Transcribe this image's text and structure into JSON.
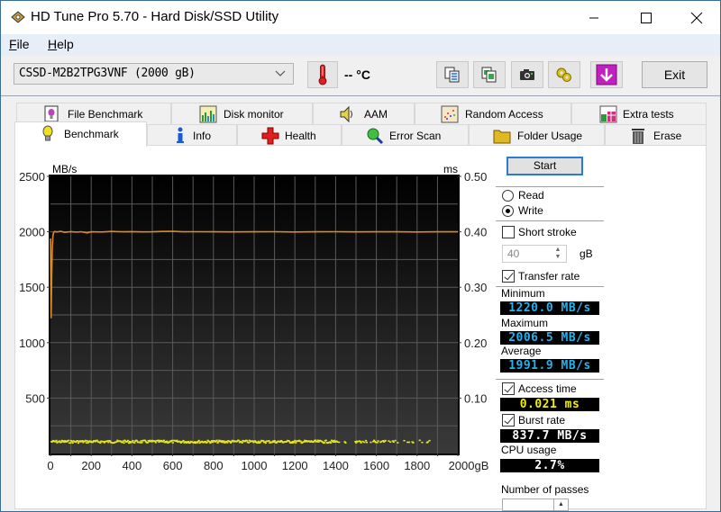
{
  "window": {
    "title": "HD Tune Pro 5.70 - Hard Disk/SSD Utility",
    "controls": [
      "minimize",
      "maximize",
      "close"
    ]
  },
  "menu": {
    "items": [
      {
        "label": "File",
        "accel": "F",
        "rest": "ile"
      },
      {
        "label": "Help",
        "accel": "H",
        "rest": "elp"
      }
    ]
  },
  "toolbar": {
    "drive": "CSSD-M2B2TPG3VNF (2000 gB)",
    "temperature": "-- °C",
    "buttons": [
      {
        "name": "copy-text-button",
        "icon": "copy-text-icon"
      },
      {
        "name": "copy-screenshot-button",
        "icon": "copy-image-icon"
      },
      {
        "name": "screenshot-button",
        "icon": "camera-icon"
      },
      {
        "name": "options-button",
        "icon": "gears-icon"
      },
      {
        "name": "save-button",
        "icon": "download-arrow-icon"
      }
    ],
    "exit_label": "Exit"
  },
  "tabs": {
    "row1": [
      {
        "label": "File Benchmark",
        "icon": "file-benchmark-icon"
      },
      {
        "label": "Disk monitor",
        "icon": "disk-monitor-icon"
      },
      {
        "label": "AAM",
        "icon": "speaker-icon"
      },
      {
        "label": "Random Access",
        "icon": "random-access-icon"
      },
      {
        "label": "Extra tests",
        "icon": "extra-tests-icon"
      }
    ],
    "row2": [
      {
        "label": "Benchmark",
        "icon": "lightbulb-icon",
        "active": true
      },
      {
        "label": "Info",
        "icon": "info-icon"
      },
      {
        "label": "Health",
        "icon": "health-cross-icon"
      },
      {
        "label": "Error Scan",
        "icon": "magnifier-icon"
      },
      {
        "label": "Folder Usage",
        "icon": "folder-icon"
      },
      {
        "label": "Erase",
        "icon": "trash-icon"
      }
    ]
  },
  "controls": {
    "start_label": "Start",
    "mode_options": [
      {
        "label": "Read",
        "selected": false
      },
      {
        "label": "Write",
        "selected": true
      }
    ],
    "short_stroke": {
      "label": "Short stroke",
      "checked": false,
      "value": "40",
      "unit": "gB"
    },
    "transfer_rate": {
      "label": "Transfer rate",
      "checked": true
    },
    "minimum": {
      "label": "Minimum",
      "value": "1220.0 MB/s"
    },
    "maximum": {
      "label": "Maximum",
      "value": "2006.5 MB/s"
    },
    "average": {
      "label": "Average",
      "value": "1991.9 MB/s"
    },
    "access_time": {
      "label": "Access time",
      "checked": true,
      "value": "0.021 ms"
    },
    "burst_rate": {
      "label": "Burst rate",
      "checked": true,
      "value": "837.7 MB/s"
    },
    "cpu_usage": {
      "label": "CPU usage",
      "value": "2.7%"
    },
    "passes": {
      "label": "Number of passes"
    }
  },
  "colors": {
    "transfer_line": "#e0891f",
    "access_dots": "#e8e81a",
    "readout_blue": "#22b4f0",
    "readout_yellow": "#f0f000",
    "readout_white": "#ffffff"
  },
  "chart_data": {
    "type": "line",
    "title": "",
    "xlabel": "gB",
    "ylabel": "MB/s",
    "y2label": "ms",
    "xlim": [
      0,
      2000
    ],
    "ylim": [
      0,
      2500
    ],
    "y2lim": [
      0,
      0.5
    ],
    "x_ticks": [
      "0",
      "200",
      "400",
      "600",
      "800",
      "1000",
      "1200",
      "1400",
      "1600",
      "1800",
      "2000gB"
    ],
    "y_ticks": [
      "500",
      "1000",
      "1500",
      "2000",
      "2500"
    ],
    "y2_ticks": [
      "0.10",
      "0.20",
      "0.30",
      "0.40",
      "0.50"
    ],
    "grid": true,
    "series": [
      {
        "name": "Transfer rate (MB/s)",
        "axis": "left",
        "x": [
          0,
          3,
          6,
          9,
          12,
          15,
          18,
          22,
          30,
          50,
          70,
          100,
          130,
          150,
          180,
          200,
          250,
          300,
          350,
          400,
          450,
          500,
          550,
          600,
          650,
          700,
          800,
          900,
          1000,
          1100,
          1200,
          1300,
          1400,
          1500,
          1600,
          1700,
          1800,
          1900,
          2000
        ],
        "values": [
          1940,
          1220,
          1620,
          1850,
          1960,
          1990,
          2000,
          2003,
          1998,
          2004,
          1995,
          2002,
          1997,
          2001,
          1990,
          2000,
          1998,
          2003,
          2000,
          2002,
          1999,
          2000,
          2003,
          2005,
          2000,
          2001,
          2000,
          1999,
          2000,
          2001,
          1998,
          2000,
          2001,
          1999,
          2000,
          2000,
          1998,
          2000,
          2000
        ]
      },
      {
        "name": "Access time (ms)",
        "axis": "right",
        "approx_value": 0.021,
        "x_range": [
          0,
          1900
        ]
      }
    ]
  }
}
